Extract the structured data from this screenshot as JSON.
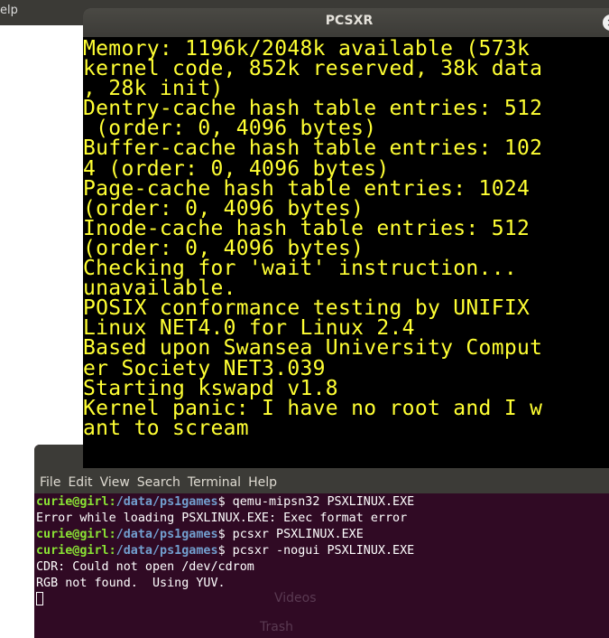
{
  "background": {
    "menu_fragment": "elp"
  },
  "pcsxr_window": {
    "title": "PCSXR",
    "close_glyph": "×",
    "screen_lines": [
      "Memory: 1196k/2048k available (573k",
      "kernel code, 852k reserved, 38k data",
      ", 28k init)",
      "Dentry-cache hash table entries: 512",
      " (order: 0, 4096 bytes)",
      "Buffer-cache hash table entries: 102",
      "4 (order: 0, 4096 bytes)",
      "Page-cache hash table entries: 1024",
      "(order: 0, 4096 bytes)",
      "Inode-cache hash table entries: 512",
      "(order: 0, 4096 bytes)",
      "Checking for 'wait' instruction...",
      "unavailable.",
      "POSIX conformance testing by UNIFIX",
      "Linux NET4.0 for Linux 2.4",
      "Based upon Swansea University Comput",
      "er Society NET3.039",
      "Starting kswapd v1.8",
      "Kernel panic: I have no root and I w",
      "ant to scream"
    ],
    "text_color": "#ffff33"
  },
  "terminal": {
    "menu": [
      "File",
      "Edit",
      "View",
      "Search",
      "Terminal",
      "Help"
    ],
    "prompt_user": "curie@girl",
    "prompt_path": "/data/ps1games",
    "lines": [
      {
        "type": "cmd",
        "text": "qemu-mipsn32 PSXLINUX.EXE"
      },
      {
        "type": "out",
        "text": "Error while loading PSXLINUX.EXE: Exec format error"
      },
      {
        "type": "cmd",
        "text": "pcsxr PSXLINUX.EXE"
      },
      {
        "type": "cmd",
        "text": "pcsxr -nogui PSXLINUX.EXE"
      },
      {
        "type": "out",
        "text": "CDR: Could not open /dev/cdrom"
      },
      {
        "type": "out",
        "text": "RGB not found.  Using YUV."
      }
    ],
    "ghost_items": [
      "Videos",
      "Trash"
    ]
  }
}
